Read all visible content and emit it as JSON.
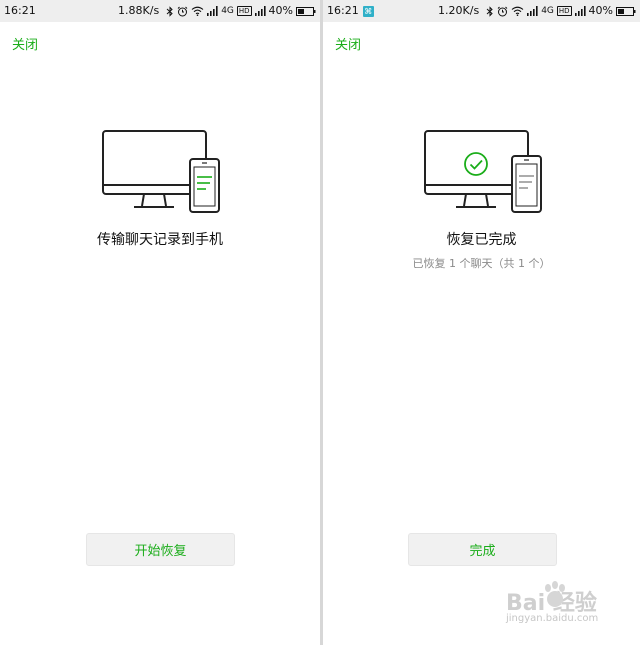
{
  "left_screen": {
    "status_bar": {
      "time": "16:21",
      "network_speed": "1.88K/s",
      "network_type": "4G",
      "hd_label": "HD",
      "battery_percent": "40%",
      "icons": [
        "bluetooth-icon",
        "alarm-icon",
        "wifi-icon",
        "signal-icon",
        "battery-icon"
      ]
    },
    "close_label": "关闭",
    "title": "传输聊天记录到手机",
    "action_label": "开始恢复"
  },
  "right_screen": {
    "status_bar": {
      "time": "16:21",
      "notification_icon": "app-notification-icon",
      "network_speed": "1.20K/s",
      "network_type": "4G",
      "hd_label": "HD",
      "battery_percent": "40%",
      "icons": [
        "bluetooth-icon",
        "alarm-icon",
        "wifi-icon",
        "signal-icon",
        "battery-icon"
      ]
    },
    "close_label": "关闭",
    "title": "恢复已完成",
    "subtitle": "已恢复 1 个聊天（共 1 个）",
    "action_label": "完成"
  },
  "watermark": {
    "main": "Bai 经验",
    "sub": "jingyan.baidu.com"
  },
  "colors": {
    "accent_green": "#1aad19",
    "status_bar_bg": "#eeeeee",
    "button_bg": "#f1f1f1",
    "subtitle_gray": "#8a8a8a"
  }
}
